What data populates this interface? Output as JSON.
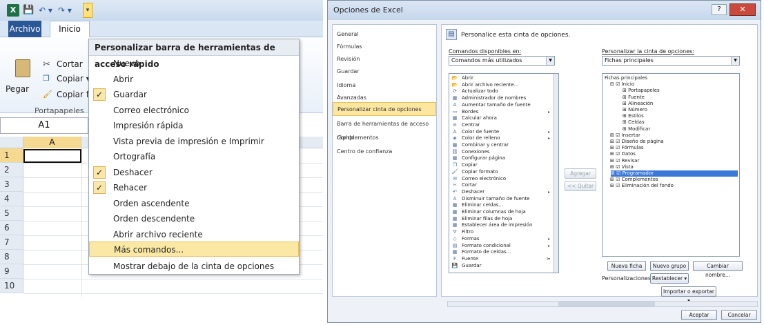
{
  "excel": {
    "tabs": {
      "archivo": "Archivo",
      "inicio": "Inicio"
    },
    "clipboard": {
      "paste": "Pegar",
      "cut": "Cortar",
      "copy": "Copiar ▾",
      "format": "Copiar fo",
      "group": "Portapapeles"
    },
    "namebox": "A1",
    "column_a": "A",
    "rows": [
      "1",
      "2",
      "3",
      "4",
      "5",
      "6",
      "7",
      "8",
      "9",
      "10"
    ],
    "qat_menu": {
      "header": "Personalizar barra de herramientas de acceso rápido",
      "items": [
        {
          "label": "Nuevo",
          "checked": false
        },
        {
          "label": "Abrir",
          "checked": false
        },
        {
          "label": "Guardar",
          "checked": true
        },
        {
          "label": "Correo electrónico",
          "checked": false
        },
        {
          "label": "Impresión rápida",
          "checked": false
        },
        {
          "label": "Vista previa de impresión e Imprimir",
          "checked": false
        },
        {
          "label": "Ortografía",
          "checked": false
        },
        {
          "label": "Deshacer",
          "checked": true
        },
        {
          "label": "Rehacer",
          "checked": true
        },
        {
          "label": "Orden ascendente",
          "checked": false
        },
        {
          "label": "Orden descendente",
          "checked": false
        },
        {
          "label": "Abrir archivo reciente",
          "checked": false
        },
        {
          "label": "Más comandos...",
          "checked": false
        },
        {
          "label": "Mostrar debajo de la cinta de opciones",
          "checked": false
        }
      ],
      "check_mark": "✓"
    }
  },
  "options": {
    "title": "Opciones de Excel",
    "help": "?",
    "close": "✕",
    "nav": [
      "General",
      "Fórmulas",
      "Revisión",
      "Guardar",
      "Idioma",
      "Avanzadas",
      "Personalizar cinta de opciones",
      "Barra de herramientas de acceso rápido",
      "Complementos",
      "Centro de confianza"
    ],
    "heading": "Personalice esta cinta de opciones.",
    "commands_label": "Comandos disponibles en:",
    "commands_value": "Comandos más utilizados",
    "ribbon_label": "Personalizar la cinta de opciones:",
    "ribbon_value": "Fichas principales",
    "commands": [
      {
        "label": "Abrir",
        "sub": ""
      },
      {
        "label": "Abrir archivo reciente...",
        "sub": ""
      },
      {
        "label": "Actualizar todo",
        "sub": ""
      },
      {
        "label": "Administrador de nombres",
        "sub": ""
      },
      {
        "label": "Aumentar tamaño de fuente",
        "sub": ""
      },
      {
        "label": "Bordes",
        "sub": "▸"
      },
      {
        "label": "Calcular ahora",
        "sub": ""
      },
      {
        "label": "Centrar",
        "sub": ""
      },
      {
        "label": "Color de fuente",
        "sub": "▸"
      },
      {
        "label": "Color de relleno",
        "sub": "▸"
      },
      {
        "label": "Combinar y centrar",
        "sub": ""
      },
      {
        "label": "Conexiones",
        "sub": ""
      },
      {
        "label": "Configurar página",
        "sub": ""
      },
      {
        "label": "Copiar",
        "sub": ""
      },
      {
        "label": "Copiar formato",
        "sub": ""
      },
      {
        "label": "Correo electrónico",
        "sub": ""
      },
      {
        "label": "Cortar",
        "sub": ""
      },
      {
        "label": "Deshacer",
        "sub": "▸"
      },
      {
        "label": "Disminuir tamaño de fuente",
        "sub": ""
      },
      {
        "label": "Eliminar celdas...",
        "sub": ""
      },
      {
        "label": "Eliminar columnas de hoja",
        "sub": ""
      },
      {
        "label": "Eliminar filas de hoja",
        "sub": ""
      },
      {
        "label": "Establecer área de impresión",
        "sub": ""
      },
      {
        "label": "Filtro",
        "sub": ""
      },
      {
        "label": "Formas",
        "sub": "▸"
      },
      {
        "label": "Formato condicional",
        "sub": "▸"
      },
      {
        "label": "Formato de celdas...",
        "sub": ""
      },
      {
        "label": "Fuente",
        "sub": "I▾"
      },
      {
        "label": "Guardar",
        "sub": ""
      }
    ],
    "tree": [
      {
        "label": "Fichas principales",
        "indent": 0,
        "hl": false
      },
      {
        "label": "⊟ ☑ Inicio",
        "indent": 1,
        "hl": false
      },
      {
        "label": "⊞ Portapapeles",
        "indent": 2,
        "hl": false
      },
      {
        "label": "⊞ Fuente",
        "indent": 2,
        "hl": false
      },
      {
        "label": "⊞ Alineación",
        "indent": 2,
        "hl": false
      },
      {
        "label": "⊞ Número",
        "indent": 2,
        "hl": false
      },
      {
        "label": "⊞ Estilos",
        "indent": 2,
        "hl": false
      },
      {
        "label": "⊞ Celdas",
        "indent": 2,
        "hl": false
      },
      {
        "label": "⊞ Modificar",
        "indent": 2,
        "hl": false
      },
      {
        "label": "⊞ ☑ Insertar",
        "indent": 1,
        "hl": false
      },
      {
        "label": "⊞ ☑ Diseño de página",
        "indent": 1,
        "hl": false
      },
      {
        "label": "⊞ ☑ Fórmulas",
        "indent": 1,
        "hl": false
      },
      {
        "label": "⊞ ☑ Datos",
        "indent": 1,
        "hl": false
      },
      {
        "label": "⊞ ☑ Revisar",
        "indent": 1,
        "hl": false
      },
      {
        "label": "⊞ ☑ Vista",
        "indent": 1,
        "hl": false
      },
      {
        "label": "⊞ ☑ Programador",
        "indent": 1,
        "hl": true
      },
      {
        "label": "⊞ ☑ Complementos",
        "indent": 1,
        "hl": false
      },
      {
        "label": "⊞ ☑ Eliminación del fondo",
        "indent": 1,
        "hl": false
      }
    ],
    "add_button": "Agregar >>",
    "remove_button": "<< Quitar",
    "new_tab": "Nueva ficha",
    "new_group": "Nuevo grupo",
    "rename": "Cambiar nombre...",
    "custom_label": "Personalizaciones:",
    "reset": "Restablecer ▾",
    "import_export": "Importar o exportar ▾",
    "ok": "Aceptar",
    "cancel": "Cancelar"
  }
}
